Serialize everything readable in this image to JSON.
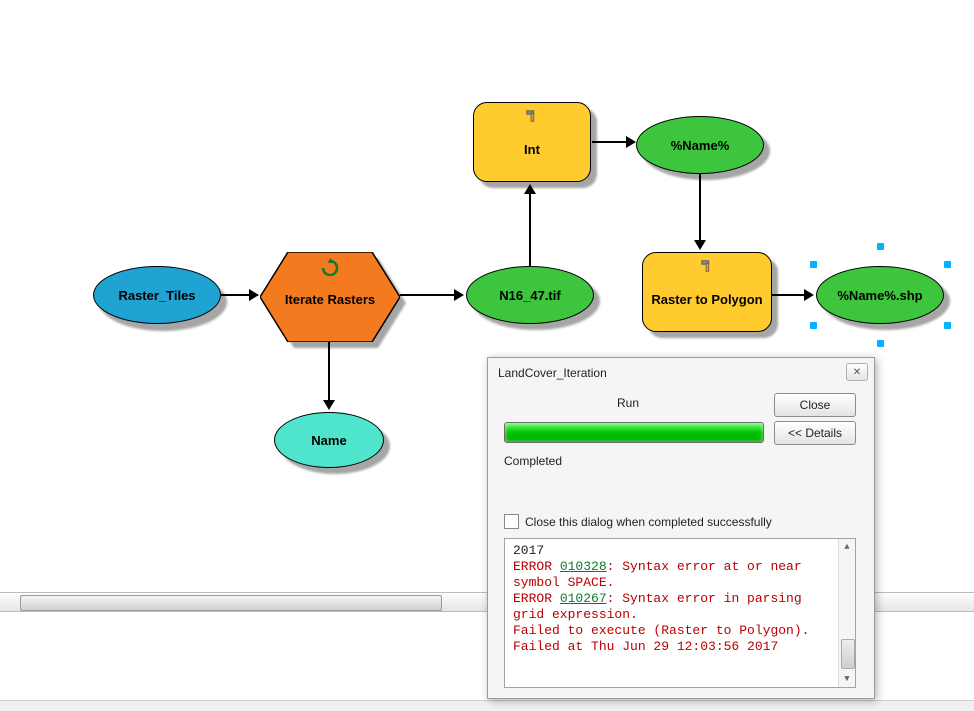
{
  "model": {
    "raster_tiles": "Raster_Tiles",
    "iterate_rasters": "Iterate Rasters",
    "name_output": "Name",
    "current_raster": "N16_47.tif",
    "int_tool": "Int",
    "name_var": "%Name%",
    "raster_to_polygon": "Raster to Polygon",
    "output_shp": "%Name%.shp"
  },
  "dialog": {
    "title": "LandCover_Iteration",
    "run_label": "Run",
    "close_btn": "Close",
    "details_btn": "<< Details",
    "status": "Completed",
    "checkbox_label": "Close this dialog when completed successfully",
    "log": {
      "line1": "2017",
      "err1_prefix": "ERROR ",
      "err1_code": "010328",
      "err1_suffix": ": Syntax error at or near symbol SPACE.",
      "err2_prefix": "ERROR ",
      "err2_code": "010267",
      "err2_suffix": ": Syntax error in parsing grid expression.",
      "fail1": "Failed to execute (Raster to Polygon).",
      "fail2": "Failed at Thu Jun 29 12:03:56 2017"
    }
  }
}
